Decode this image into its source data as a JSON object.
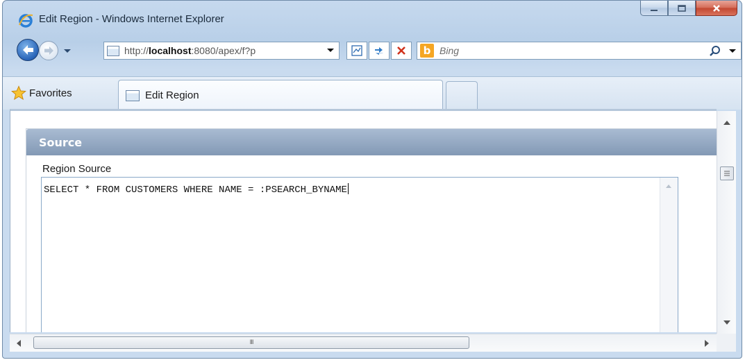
{
  "window": {
    "title": "Edit Region - Windows Internet Explorer",
    "icon": "ie-icon",
    "controls": [
      "minimize-icon",
      "maximize-icon",
      "close-icon"
    ]
  },
  "navigation": {
    "address_prefix": "http://",
    "address_host": "localhost",
    "address_rest": ":8080/apex/f?p",
    "search_placeholder": "Bing",
    "search_provider_icon": "bing-logo"
  },
  "favorites_bar": {
    "favorites_label": "Favorites",
    "tabs": [
      {
        "label": "Edit Region",
        "icon": "page-icon"
      }
    ]
  },
  "page": {
    "region_title": "Source",
    "field_label": "Region Source",
    "field_value": "SELECT * FROM CUSTOMERS WHERE NAME = :PSEARCH_BYNAME"
  },
  "scrollbars": {
    "horizontal_grip": "III"
  },
  "colors": {
    "region_header": "#8399b5",
    "chrome": "#c6d9ee",
    "close_button": "#c24731"
  }
}
